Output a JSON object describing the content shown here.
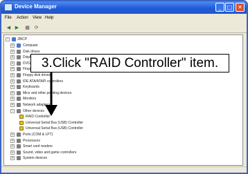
{
  "window": {
    "title": "Device Manager",
    "min_label": "_",
    "max_label": "□",
    "close_label": "✕"
  },
  "menu": [
    "File",
    "Action",
    "View",
    "Help"
  ],
  "toolbar_icons": [
    "back-icon",
    "forward-icon",
    "properties-icon",
    "refresh-icon"
  ],
  "tree": {
    "root": "JBICP",
    "items": [
      {
        "label": "Computer",
        "icon": "computer-icon"
      },
      {
        "label": "Disk drives",
        "icon": "disk-icon"
      },
      {
        "label": "Display adapters",
        "icon": "display-icon"
      },
      {
        "label": "DVD/CD-ROM drives",
        "icon": "cdrom-icon"
      },
      {
        "label": "Floppy disk controllers",
        "icon": "floppy-icon"
      },
      {
        "label": "Floppy disk drives",
        "icon": "floppy-icon"
      },
      {
        "label": "IDE ATA/ATAPI controllers",
        "icon": "ide-icon"
      },
      {
        "label": "Keyboards",
        "icon": "keyboard-icon"
      },
      {
        "label": "Mice and other pointing devices",
        "icon": "mouse-icon"
      },
      {
        "label": "Monitors",
        "icon": "monitor-icon"
      },
      {
        "label": "Network adapters",
        "icon": "network-icon"
      },
      {
        "label": "Other devices",
        "icon": "unknown-device-icon"
      },
      {
        "label": "RAID Controller",
        "icon": "warning-device-icon"
      },
      {
        "label": "Universal Serial Bus (USB) Controller",
        "icon": "warning-device-icon"
      },
      {
        "label": "Universal Serial Bus (USB) Controller",
        "icon": "warning-device-icon"
      },
      {
        "label": "Ports (COM & LPT)",
        "icon": "port-icon"
      },
      {
        "label": "Processors",
        "icon": "cpu-icon"
      },
      {
        "label": "Smart card readers",
        "icon": "card-icon"
      },
      {
        "label": "Sound, video and game controllers",
        "icon": "sound-icon"
      },
      {
        "label": "System devices",
        "icon": "system-icon"
      }
    ]
  },
  "callout": {
    "text": "3.Click \"RAID Controller\" item."
  },
  "colors": {
    "titlebar": "#2458c8",
    "warning": "#e6c21a",
    "callout_border": "#000000"
  }
}
